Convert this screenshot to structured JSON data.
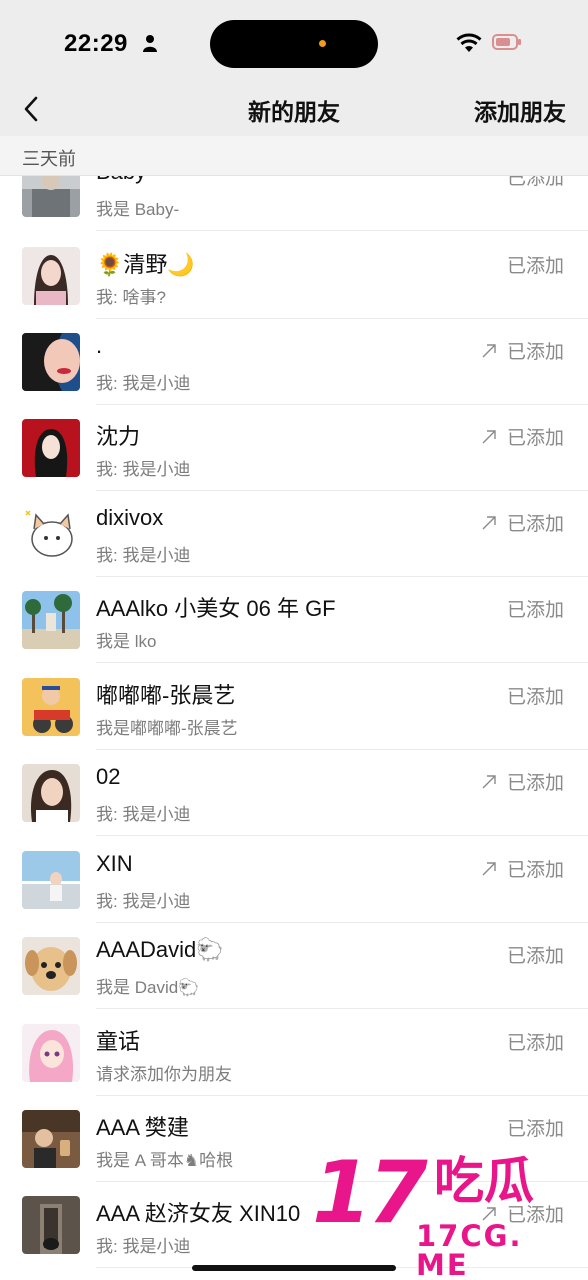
{
  "status_bar": {
    "time": "22:29"
  },
  "nav": {
    "title": "新的朋友",
    "add_friend": "添加朋友"
  },
  "section": {
    "label": "三天前"
  },
  "friends": [
    {
      "name": "Baby-",
      "subtitle": "我是 Baby-",
      "status": "已添加",
      "shared": false
    },
    {
      "name": "🌻清野🌙",
      "subtitle": "我: 啥事?",
      "status": "已添加",
      "shared": false
    },
    {
      "name": ".",
      "subtitle": "我: 我是小迪",
      "status": "已添加",
      "shared": true
    },
    {
      "name": "沈力",
      "subtitle": "我: 我是小迪",
      "status": "已添加",
      "shared": true
    },
    {
      "name": "dixivox",
      "subtitle": "我: 我是小迪",
      "status": "已添加",
      "shared": true
    },
    {
      "name": "AAAlko 小美女 06 年 GF",
      "subtitle": "我是 lko",
      "status": "已添加",
      "shared": false
    },
    {
      "name": "嘟嘟嘟-张晨艺",
      "subtitle": "我是嘟嘟嘟-张晨艺",
      "status": "已添加",
      "shared": false
    },
    {
      "name": "02",
      "subtitle": "我: 我是小迪",
      "status": "已添加",
      "shared": true
    },
    {
      "name": "XIN",
      "subtitle": "我: 我是小迪",
      "status": "已添加",
      "shared": true
    },
    {
      "name": "AAADavid🐑",
      "subtitle": "我是 David🐑",
      "status": "已添加",
      "shared": false
    },
    {
      "name": "童话",
      "subtitle": "请求添加你为朋友",
      "status": "已添加",
      "shared": false
    },
    {
      "name": "AAA 樊建",
      "subtitle": "我是 A 哥本♞哈根",
      "status": "已添加",
      "shared": false
    },
    {
      "name": "AAA 赵济女友 XIN10",
      "subtitle": "我: 我是小迪",
      "status": "已添加",
      "shared": true
    }
  ],
  "watermark": {
    "number": "17",
    "text": "吃瓜",
    "domain": "17CG. ME"
  },
  "colors": {
    "nav_bg": "#ededed",
    "watermark": "#e8168a",
    "status_text": "#8a8a8a"
  },
  "icons": [
    "person-icon",
    "wifi-icon",
    "battery-icon",
    "back-icon",
    "share-arrow-icon"
  ]
}
